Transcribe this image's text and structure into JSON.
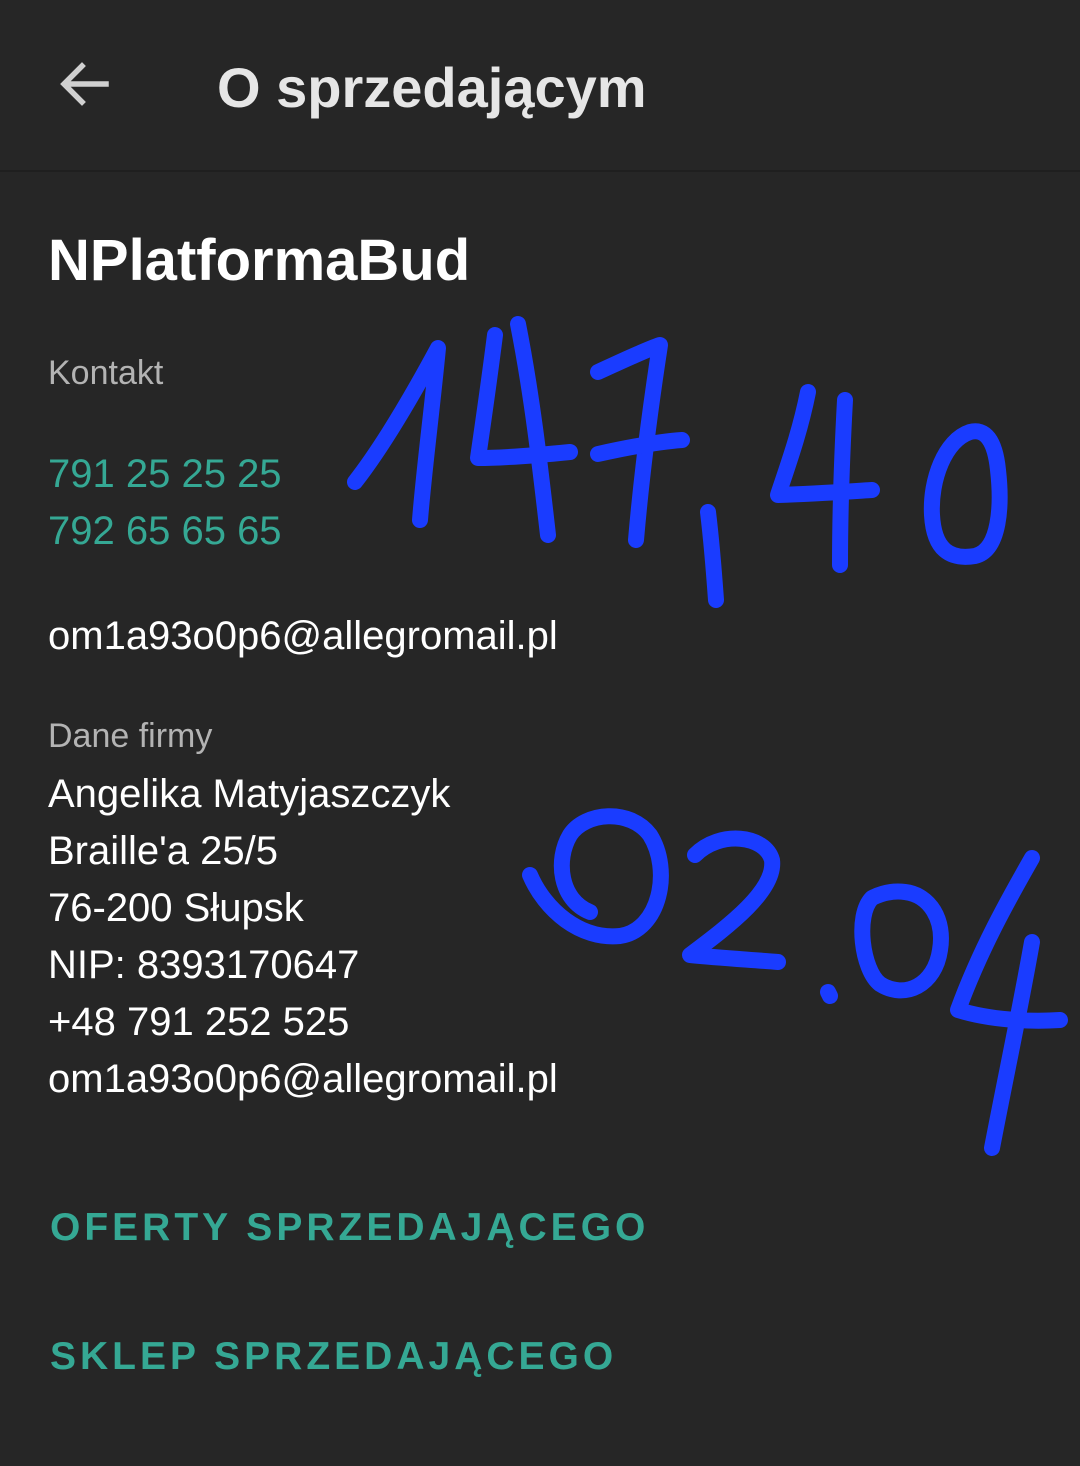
{
  "app_bar": {
    "title": "O sprzedającym",
    "back_icon": "arrow-back-icon"
  },
  "seller": {
    "name": "NPlatformaBud"
  },
  "contact": {
    "label": "Kontakt",
    "phones": [
      "791 25 25 25",
      "792 65 65 65"
    ],
    "email": "om1a93o0p6@allegromail.pl"
  },
  "company": {
    "label": "Dane firmy",
    "lines": [
      "Angelika Matyjaszczyk",
      "Braille'a 25/5",
      "76-200 Słupsk",
      "NIP: 8393170647",
      "+48 791 252 525",
      "om1a93o0p6@allegromail.pl"
    ]
  },
  "actions": {
    "offers": "OFERTY SPRZEDAJĄCEGO",
    "shop": "SKLEP SPRZEDAJĄCEGO"
  },
  "handwriting": {
    "amount": "147,40",
    "date": "02.04",
    "ink_color": "#1a3cff"
  },
  "colors": {
    "background": "#262626",
    "accent": "#35a894",
    "muted": "#b3b3b3"
  }
}
